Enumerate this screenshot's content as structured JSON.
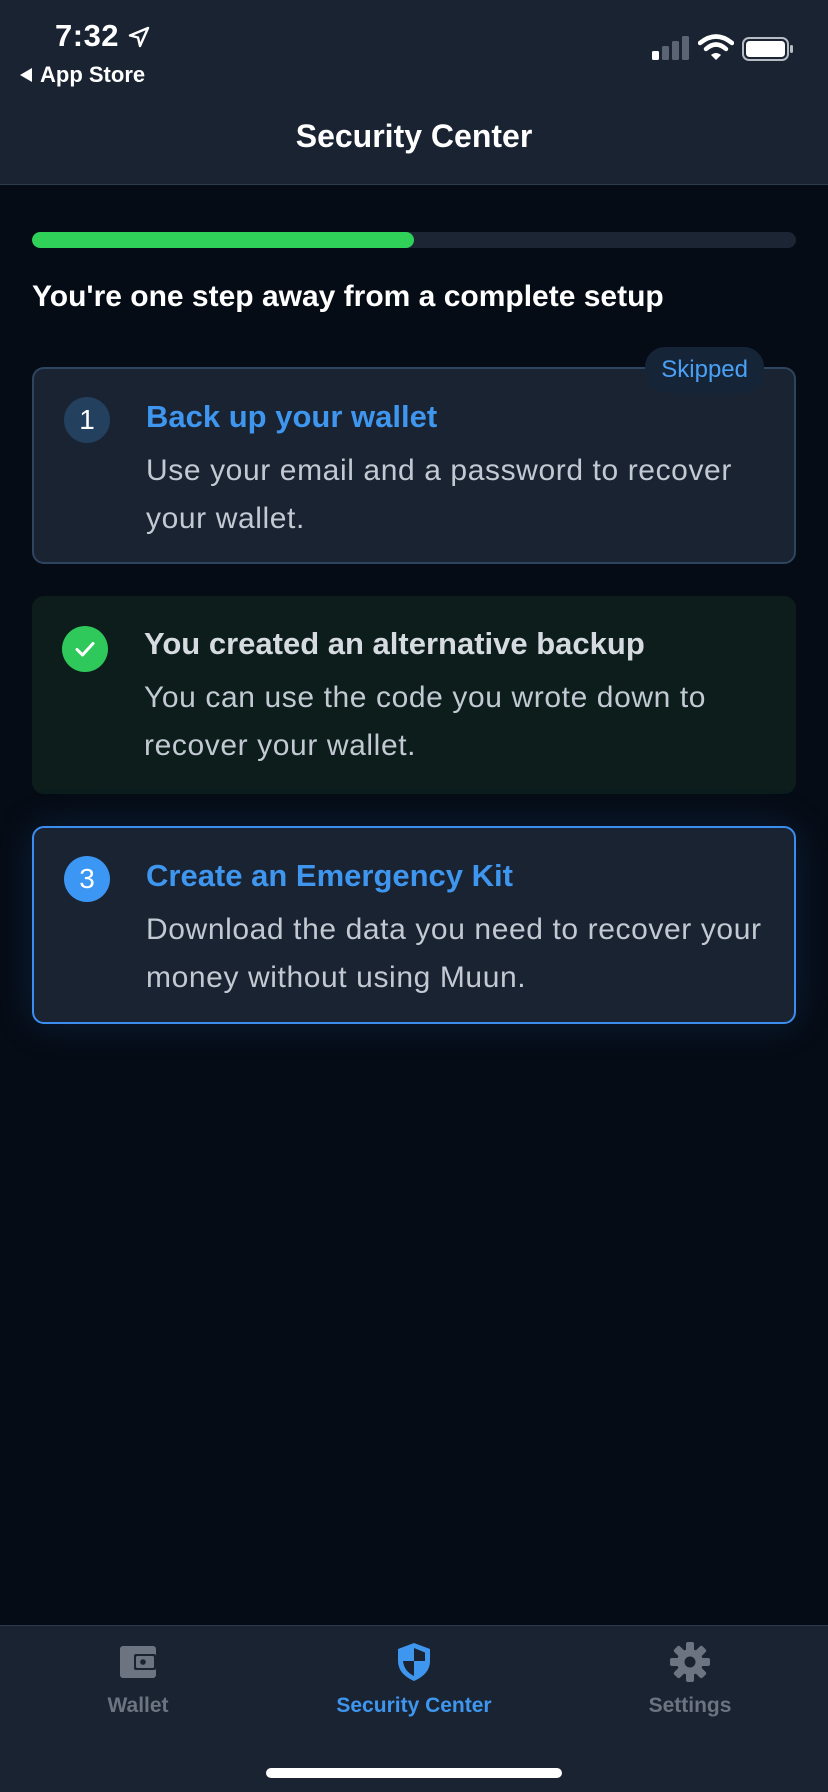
{
  "status_bar": {
    "time": "7:32",
    "back_label": "App Store"
  },
  "nav": {
    "title": "Security Center"
  },
  "progress": {
    "fraction": 0.5,
    "color": "#2fd158"
  },
  "headline": "You're one step away from a complete setup",
  "steps": [
    {
      "number": "1",
      "title": "Back up your wallet",
      "description": "Use your email and a password to recover your wallet.",
      "badge": "Skipped",
      "state": "skipped"
    },
    {
      "number": "",
      "title": "You created an alternative backup",
      "description": "You can use the code you wrote down to recover your wallet.",
      "state": "done",
      "icon": "check-icon"
    },
    {
      "number": "3",
      "title": "Create an Emergency Kit",
      "description": "Download the data you need to recover your money without using Muun.",
      "state": "active"
    }
  ],
  "tabs": [
    {
      "label": "Wallet",
      "icon": "wallet-icon",
      "active": false
    },
    {
      "label": "Security Center",
      "icon": "shield-icon",
      "active": true
    },
    {
      "label": "Settings",
      "icon": "gear-icon",
      "active": false
    }
  ],
  "colors": {
    "accent": "#3f96ef",
    "success": "#2fc85a",
    "background": "#060c15",
    "surface": "#1a2332"
  }
}
